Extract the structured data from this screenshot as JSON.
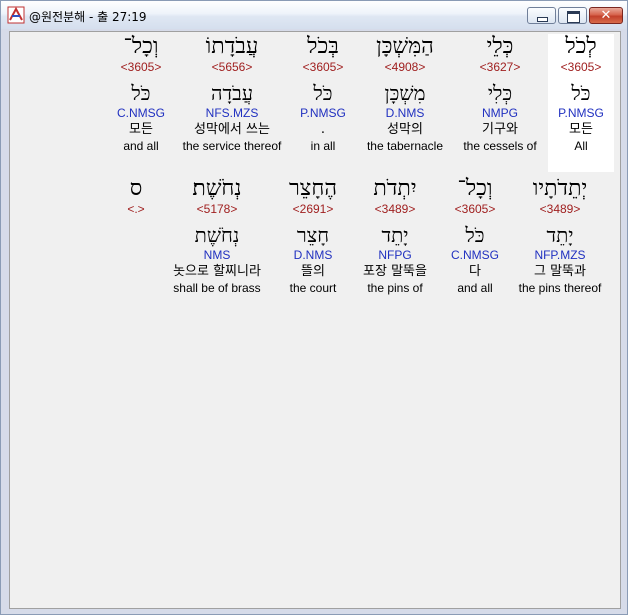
{
  "window": {
    "title": "@원전분해 - 출 27:19"
  },
  "rows": [
    {
      "words": [
        {
          "hebrew": "לְכֹל",
          "strong": "<3605>",
          "lemma": "כֹּל",
          "morph": "P.NMSG",
          "korean": "모든",
          "english": "All",
          "highlight": true
        },
        {
          "hebrew": "כְּלֵי",
          "strong": "<3627>",
          "lemma": "כְּלִי",
          "morph": "NMPG",
          "korean": "기구와",
          "english": "the cessels of",
          "highlight": false
        },
        {
          "hebrew": "הַמִּשְׁכָּן",
          "strong": "<4908>",
          "lemma": "מִשְׁכָּן",
          "morph": "D.NMS",
          "korean": "성막의",
          "english": "the tabernacle",
          "highlight": false
        },
        {
          "hebrew": "בְּכֹל",
          "strong": "<3605>",
          "lemma": "כֹּל",
          "morph": "P.NMSG",
          "korean": ".",
          "english": "in all",
          "highlight": false
        },
        {
          "hebrew": "עֲבֹדָתוֹ",
          "strong": "<5656>",
          "lemma": "עֲבֹדָה",
          "morph": "NFS.MZS",
          "korean": "성막에서 쓰는",
          "english": "the service thereof",
          "highlight": false
        },
        {
          "hebrew": "וְכָל־",
          "strong": "<3605>",
          "lemma": "כֹּל",
          "morph": "C.NMSG",
          "korean": "모든",
          "english": "and all",
          "highlight": false
        }
      ]
    },
    {
      "words": [
        {
          "hebrew": "יְתֵדֹתָיו",
          "strong": "<3489>",
          "lemma": "יָתֵד",
          "morph": "NFP.MZS",
          "korean": "그 말뚝과",
          "english": "the pins thereof",
          "highlight": false
        },
        {
          "hebrew": "וְכָל־",
          "strong": "<3605>",
          "lemma": "כֹּל",
          "morph": "C.NMSG",
          "korean": "다",
          "english": "and all",
          "highlight": false
        },
        {
          "hebrew": "יִתְדֹת",
          "strong": "<3489>",
          "lemma": "יָתֵד",
          "morph": "NFPG",
          "korean": "포장 말뚝을",
          "english": "the pins of",
          "highlight": false
        },
        {
          "hebrew": "הֶחָצֵר",
          "strong": "<2691>",
          "lemma": "חָצֵר",
          "morph": "D.NMS",
          "korean": "뜰의",
          "english": "the court",
          "highlight": false
        },
        {
          "hebrew": "נְחֹשֶׁת׃",
          "strong": "<5178>",
          "lemma": "נְחֹשֶׁת",
          "morph": "NMS",
          "korean": "놋으로 할찌니라",
          "english": "shall be of brass",
          "highlight": false
        },
        {
          "hebrew": "ס",
          "strong": "<.>",
          "lemma": "",
          "morph": "",
          "korean": "",
          "english": "",
          "highlight": false
        }
      ]
    }
  ]
}
